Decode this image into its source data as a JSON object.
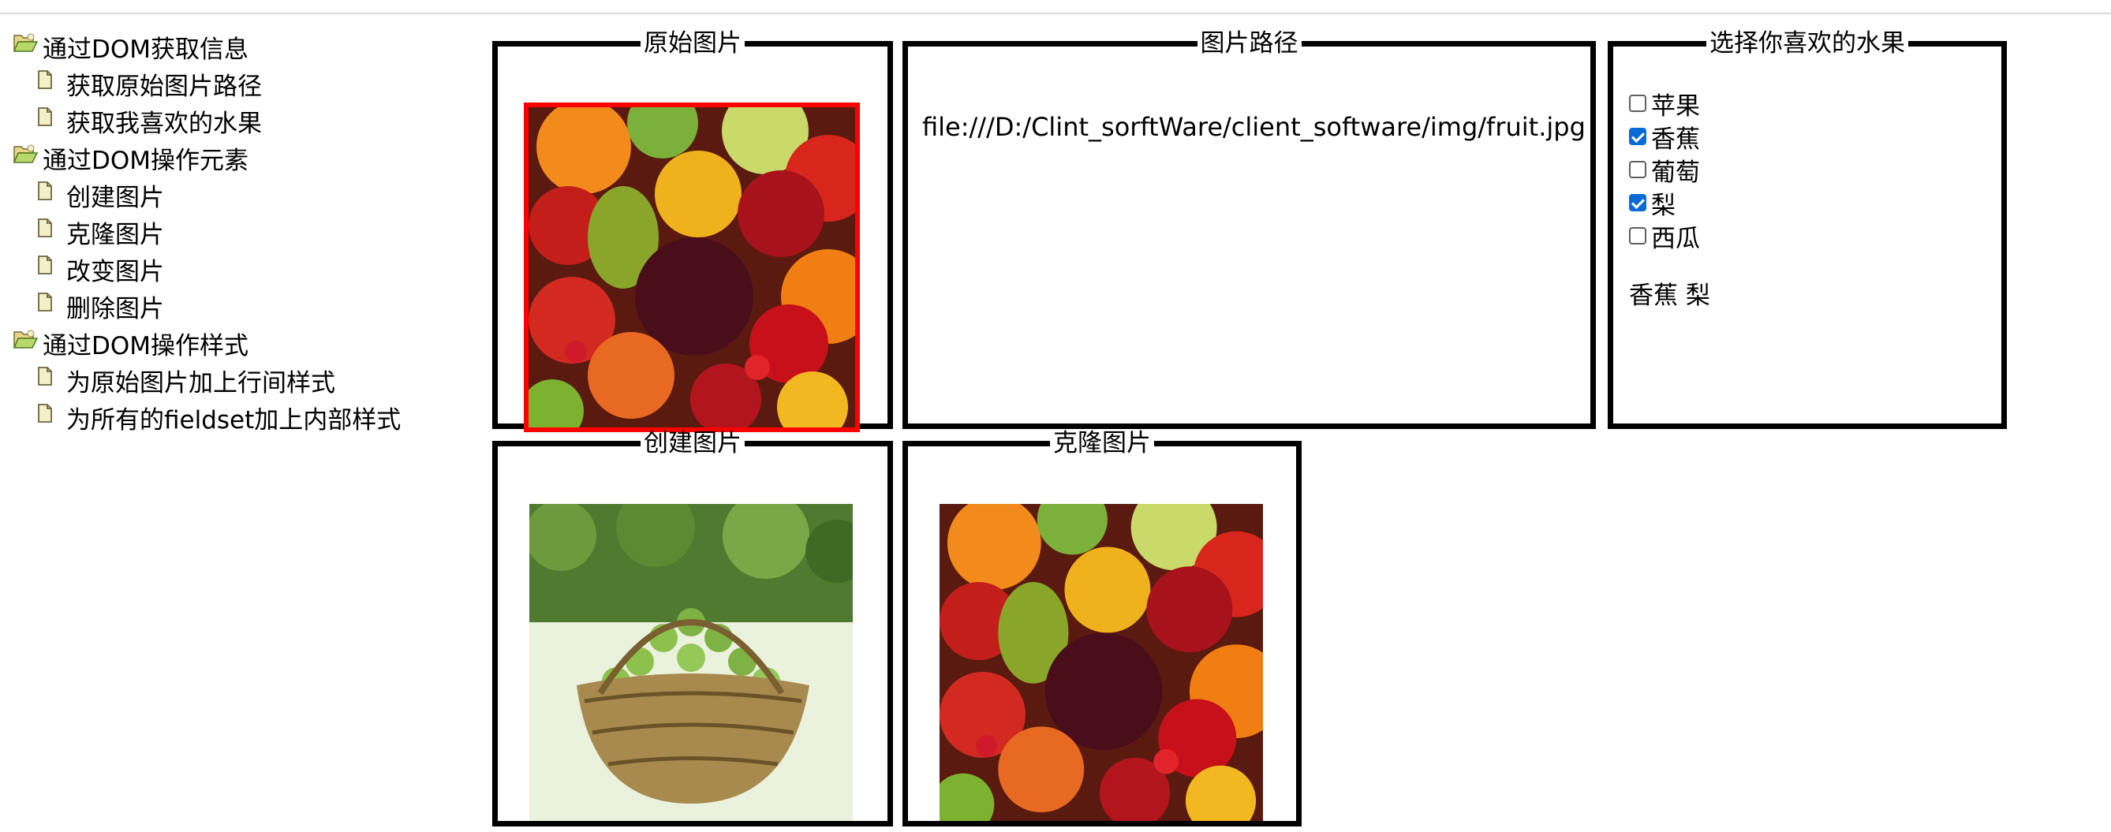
{
  "tree": [
    {
      "label": "通过DOM获取信息",
      "children": [
        "获取原始图片路径",
        "获取我喜欢的水果"
      ]
    },
    {
      "label": "通过DOM操作元素",
      "children": [
        "创建图片",
        "克隆图片",
        "改变图片",
        "删除图片"
      ]
    },
    {
      "label": "通过DOM操作样式",
      "children": [
        "为原始图片加上行间样式",
        "为所有的fieldset加上内部样式"
      ]
    }
  ],
  "panels": {
    "original": {
      "legend": "原始图片",
      "border_color": "#ff0000"
    },
    "path": {
      "legend": "图片路径",
      "value": "file:///D:/Clint_sorftWare/client_software/img/fruit.jpg"
    },
    "fruits": {
      "legend": "选择你喜欢的水果",
      "options": [
        {
          "label": "苹果",
          "checked": false
        },
        {
          "label": "香蕉",
          "checked": true
        },
        {
          "label": "葡萄",
          "checked": false
        },
        {
          "label": "梨",
          "checked": true
        },
        {
          "label": "西瓜",
          "checked": false
        }
      ],
      "selected_text": "香蕉 梨"
    },
    "create": {
      "legend": "创建图片"
    },
    "clone": {
      "legend": "克隆图片"
    }
  },
  "icons": {
    "group": "folder-open-icon",
    "leaf": "document-icon"
  },
  "colors": {
    "checkbox_checked": "#0b6bd6",
    "image_border": "#ff0000"
  }
}
